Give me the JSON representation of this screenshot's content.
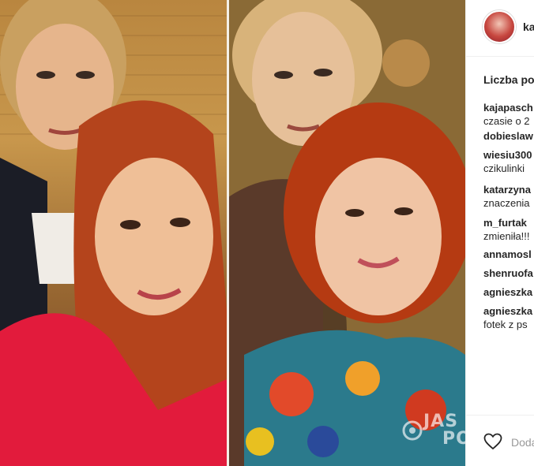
{
  "header": {
    "username": "kaja"
  },
  "likes_label": "Liczba po",
  "comments": [
    {
      "user": "kajapasch",
      "text": "czasie o 2"
    },
    {
      "user": "dobieslaw",
      "text": ""
    },
    {
      "user": "wiesiu300",
      "text": "czikulinki"
    },
    {
      "user": "katarzyna",
      "text": "znaczenia"
    },
    {
      "user": "m_furtak",
      "text": "zmieniła!!!"
    },
    {
      "user": "annamosl",
      "text": ""
    },
    {
      "user": "shenruofa",
      "text": ""
    },
    {
      "user": "agnieszka",
      "text": ""
    },
    {
      "user": "agnieszka",
      "text": "fotek z ps"
    }
  ],
  "footer": {
    "add_comment_placeholder": "Dodaj"
  },
  "watermark": {
    "line1": "JAS",
    "line2": "PO"
  },
  "colors": {
    "accent": "#262626",
    "border": "#efefef",
    "muted": "#999999"
  },
  "icons": {
    "like": "heart-icon",
    "avatar": "avatar"
  }
}
